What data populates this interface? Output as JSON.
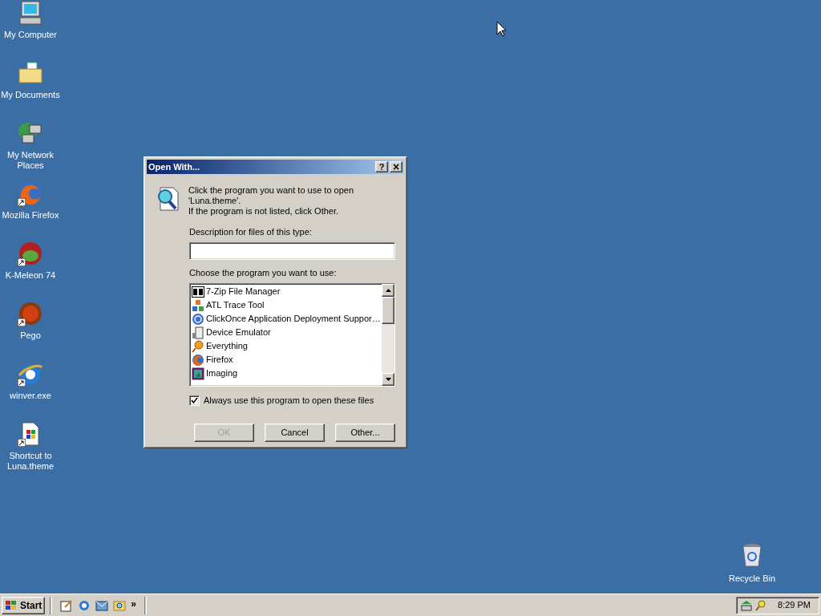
{
  "desktop_icons": [
    {
      "label": "My Computer",
      "shortcut": false
    },
    {
      "label": "My Documents",
      "shortcut": false
    },
    {
      "label": "My Network Places",
      "shortcut": false
    },
    {
      "label": "Mozilla Firefox",
      "shortcut": true
    },
    {
      "label": "K-Meleon 74",
      "shortcut": true
    },
    {
      "label": "Pego",
      "shortcut": true
    },
    {
      "label": "winver.exe",
      "shortcut": true
    },
    {
      "label": "Shortcut to Luna.theme",
      "shortcut": true
    }
  ],
  "recycle_bin": {
    "label": "Recycle Bin"
  },
  "dialog": {
    "title": "Open With...",
    "help_button": "?",
    "close_button": "×",
    "intro": [
      "Click the program you want to use to open 'Luna.theme'.",
      "If the program is not listed, click Other."
    ],
    "description_label": "Description for files of this type:",
    "programs_label": "Choose the program you want to use:",
    "programs": [
      {
        "name": "7-Zip File Manager",
        "selected": false
      },
      {
        "name": "ATL Trace Tool",
        "selected": false
      },
      {
        "name": "ClickOnce Application Deployment Suppor…",
        "selected": false
      },
      {
        "name": "Device Emulator",
        "selected": false
      },
      {
        "name": "Everything",
        "selected": false
      },
      {
        "name": "Firefox",
        "selected": false
      },
      {
        "name": "Imaging",
        "selected": false
      }
    ],
    "always_use": {
      "label": "Always use this program to open these files",
      "checked": true
    },
    "buttons": [
      {
        "label": "OK",
        "disabled": true
      },
      {
        "label": "Cancel",
        "disabled": false
      },
      {
        "label": "Other...",
        "disabled": false
      }
    ]
  },
  "taskbar": {
    "start": "Start",
    "quick_launch_more": "»",
    "clock": "8:29 PM"
  }
}
